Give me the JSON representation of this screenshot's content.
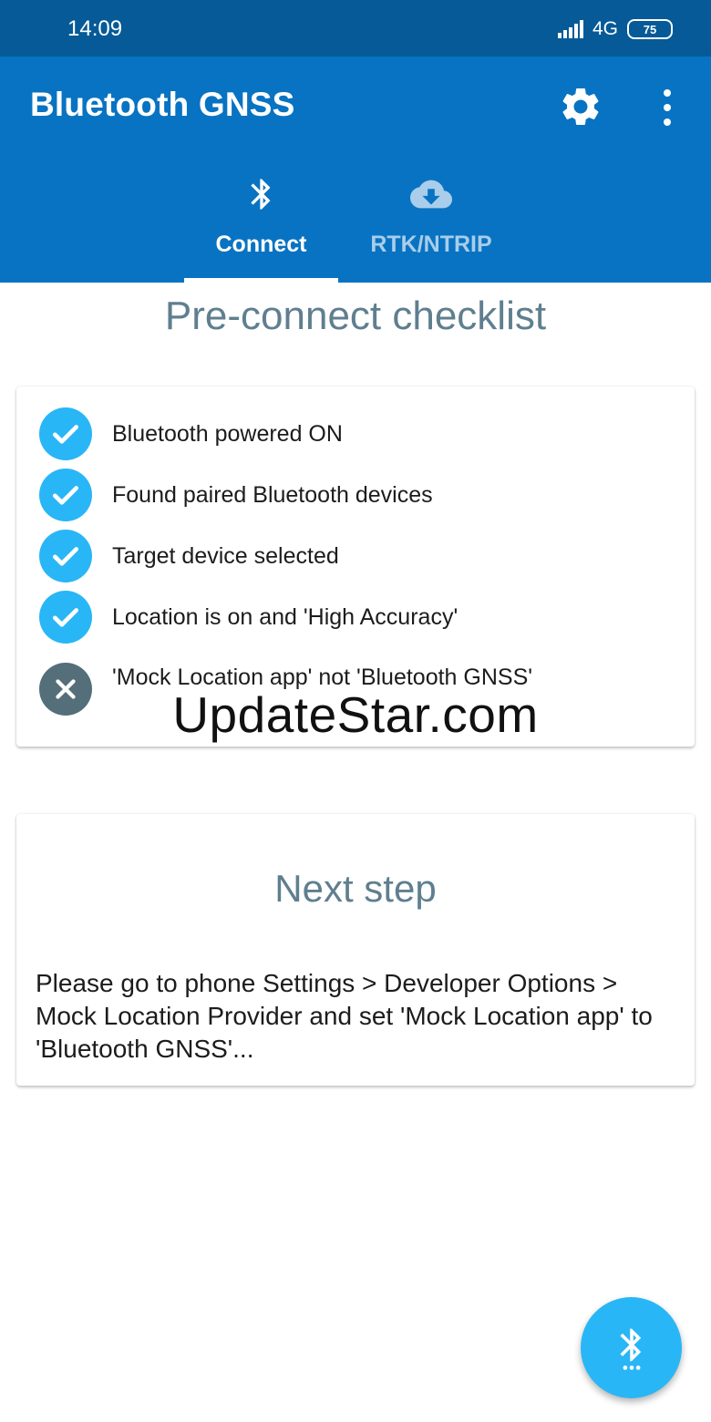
{
  "status_bar": {
    "time": "14:09",
    "network": "4G",
    "battery": "75"
  },
  "app_bar": {
    "title": "Bluetooth GNSS",
    "settings_icon": "gear-icon",
    "more_icon": "more-vert-icon"
  },
  "tabs": [
    {
      "label": "Connect",
      "icon": "bluetooth-icon",
      "selected": true
    },
    {
      "label": "RTK/NTRIP",
      "icon": "cloud-download-icon",
      "selected": false
    }
  ],
  "checklist": {
    "title": "Pre-connect checklist",
    "items": [
      {
        "label": "Bluetooth powered ON",
        "status": "ok"
      },
      {
        "label": "Found paired Bluetooth devices",
        "status": "ok"
      },
      {
        "label": "Target device selected",
        "status": "ok"
      },
      {
        "label": "Location is on and 'High Accuracy'",
        "status": "ok"
      },
      {
        "label": "'Mock Location app' not 'Bluetooth GNSS'",
        "status": "fail"
      }
    ]
  },
  "watermark": "UpdateStar.com",
  "next_step": {
    "title": "Next step",
    "body": "Please go to phone Settings > Developer Options > Mock Location Provider and set 'Mock Location app' to 'Bluetooth GNSS'..."
  },
  "fab": {
    "icon": "bluetooth-searching-icon"
  },
  "colors": {
    "status_bar": "#055a97",
    "app_bar": "#0873c2",
    "accent": "#29b6f6",
    "fail": "#546e7a",
    "heading": "#5f7f8f"
  }
}
